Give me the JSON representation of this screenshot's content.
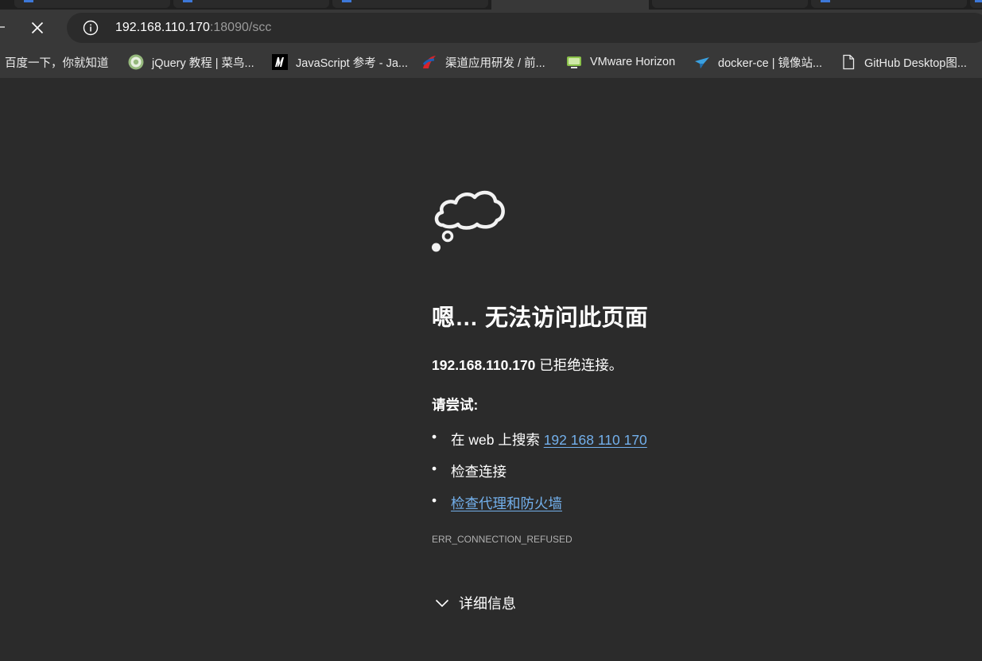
{
  "browser": {
    "address_bar": {
      "host": "192.168.110.170",
      "path": ":18090/scc"
    },
    "bookmarks": [
      {
        "label": "百度一下，你就知道",
        "icon": "none"
      },
      {
        "label": "jQuery 教程 | 菜鸟...",
        "icon": "runoob-icon"
      },
      {
        "label": "JavaScript 参考 - Ja...",
        "icon": "mdn-icon"
      },
      {
        "label": "渠道应用研发 / 前...",
        "icon": "gitlab-like-icon"
      },
      {
        "label": "VMware Horizon",
        "icon": "vmware-horizon-icon"
      },
      {
        "label": "docker-ce | 镜像站...",
        "icon": "bird-icon"
      },
      {
        "label": "GitHub Desktop图...",
        "icon": "page-icon"
      }
    ]
  },
  "error_page": {
    "title": "嗯… 无法访问此页面",
    "host": "192.168.110.170",
    "refused_text": " 已拒绝连接。",
    "try_heading": "请尝试:",
    "suggestions": [
      {
        "prefix": "在 web 上搜索 ",
        "link": "192 168 110 170"
      },
      {
        "prefix": "检查连接",
        "link": ""
      },
      {
        "prefix": "",
        "link": "检查代理和防火墙"
      }
    ],
    "error_code": "ERR_CONNECTION_REFUSED",
    "details_label": "详细信息"
  },
  "colors": {
    "page_bg": "#2b2b2b",
    "toolbar_bg": "#383838",
    "link": "#73b0ec"
  }
}
